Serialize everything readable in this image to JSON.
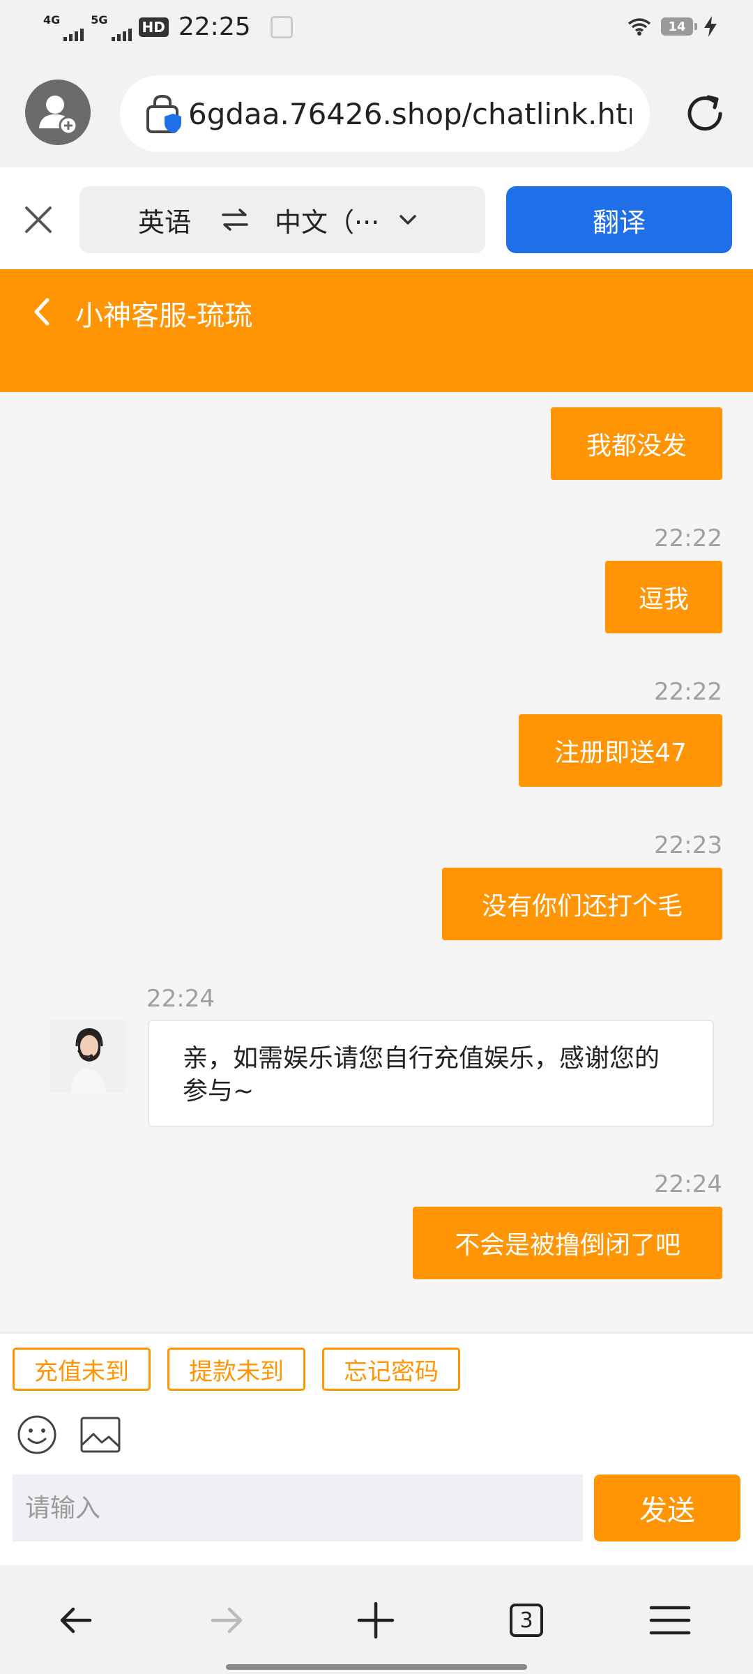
{
  "status_bar": {
    "network1": "4G",
    "network2": "5G",
    "hd": "HD",
    "time": "22:25",
    "battery": "14"
  },
  "browser": {
    "url": "6gdaa.76426.shop/chatlink.htm"
  },
  "translate_bar": {
    "source_lang": "英语",
    "target_lang": "中文（···",
    "translate_label": "翻译"
  },
  "chat": {
    "title": "小神客服-琉琉",
    "messages": [
      {
        "time": "22:22",
        "text": "逗我",
        "from": "me"
      },
      {
        "time": "22:22",
        "text": "注册即送47",
        "from": "me"
      },
      {
        "time": "22:23",
        "text": "没有你们还打个毛",
        "from": "me"
      },
      {
        "time": "22:24",
        "text": "亲，如需娱乐请您自行充值娱乐，感谢您的参与~",
        "from": "agent"
      },
      {
        "time": "22:24",
        "text": "不会是被撸倒闭了吧",
        "from": "me"
      }
    ],
    "first_partial": {
      "text": "我都没发",
      "from": "me"
    }
  },
  "quick_replies": [
    "充值未到",
    "提款未到",
    "忘记密码"
  ],
  "input": {
    "placeholder": "请输入",
    "value": "",
    "send_label": "发送"
  },
  "nav": {
    "tabs_count": "3"
  },
  "colors": {
    "accent": "#ff9505",
    "translate_blue": "#1f6fe8"
  }
}
